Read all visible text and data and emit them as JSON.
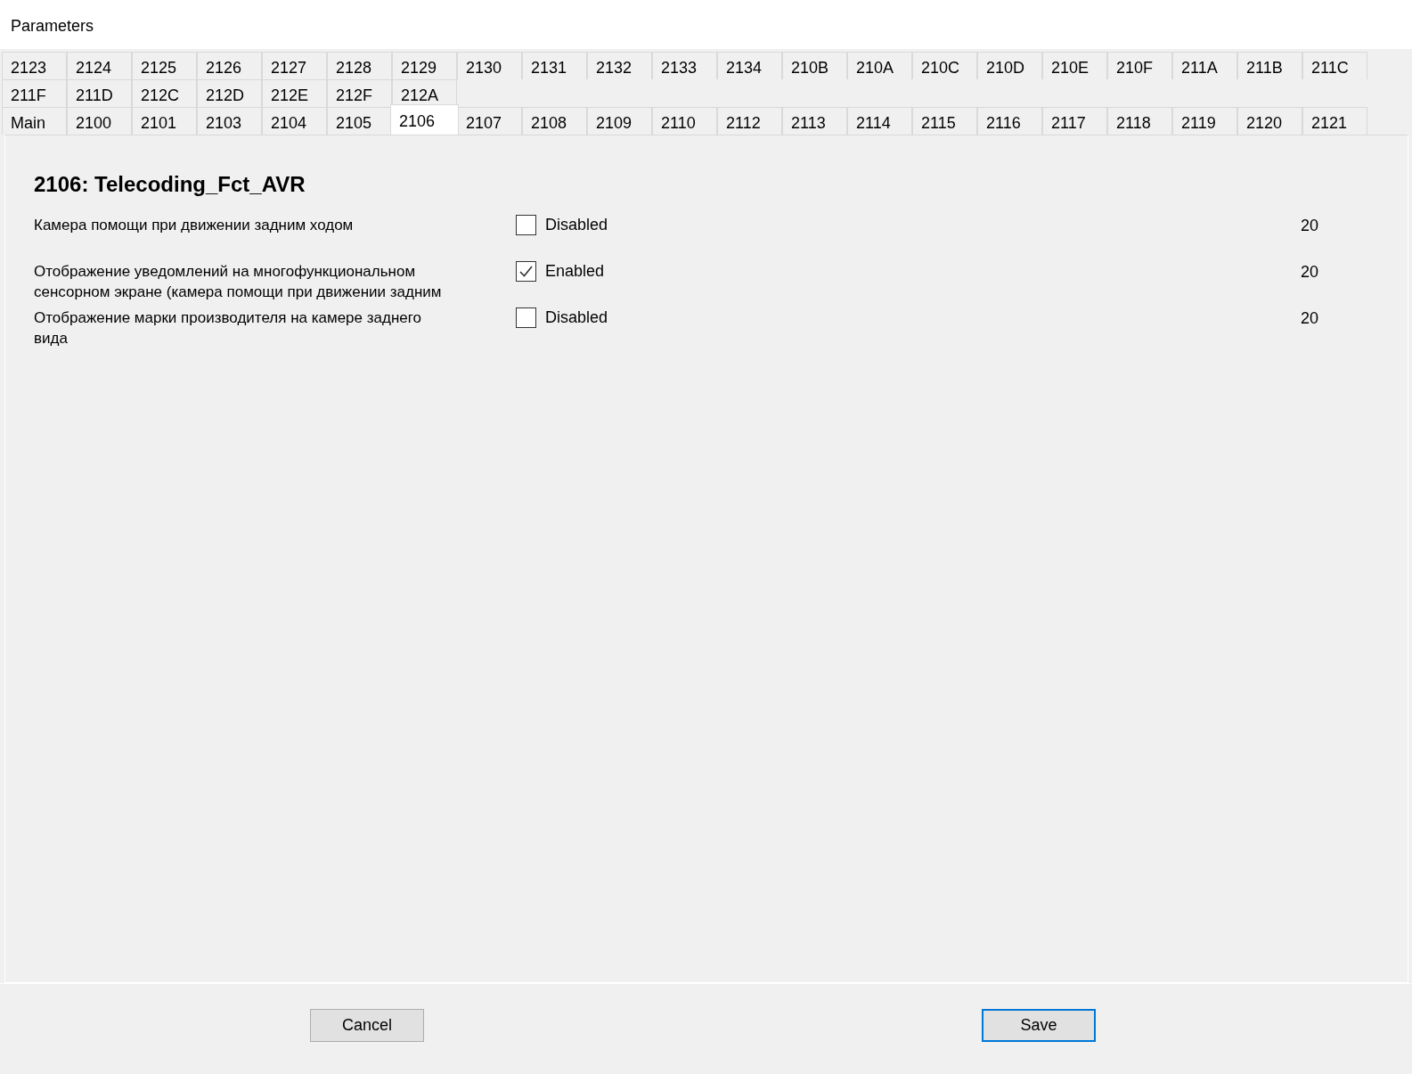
{
  "window": {
    "title": "Parameters"
  },
  "tab_rows": [
    [
      {
        "label": "2123",
        "selected": false
      },
      {
        "label": "2124",
        "selected": false
      },
      {
        "label": "2125",
        "selected": false
      },
      {
        "label": "2126",
        "selected": false
      },
      {
        "label": "2127",
        "selected": false
      },
      {
        "label": "2128",
        "selected": false
      },
      {
        "label": "2129",
        "selected": false
      },
      {
        "label": "2130",
        "selected": false
      },
      {
        "label": "2131",
        "selected": false
      },
      {
        "label": "2132",
        "selected": false
      },
      {
        "label": "2133",
        "selected": false
      },
      {
        "label": "2134",
        "selected": false
      },
      {
        "label": "210B",
        "selected": false
      },
      {
        "label": "210A",
        "selected": false
      },
      {
        "label": "210C",
        "selected": false
      },
      {
        "label": "210D",
        "selected": false
      },
      {
        "label": "210E",
        "selected": false
      },
      {
        "label": "210F",
        "selected": false
      },
      {
        "label": "211A",
        "selected": false
      },
      {
        "label": "211B",
        "selected": false
      },
      {
        "label": "211C",
        "selected": false
      }
    ],
    [
      {
        "label": "211F",
        "selected": false
      },
      {
        "label": "211D",
        "selected": false
      },
      {
        "label": "212C",
        "selected": false
      },
      {
        "label": "212D",
        "selected": false
      },
      {
        "label": "212E",
        "selected": false
      },
      {
        "label": "212F",
        "selected": false
      },
      {
        "label": "212A",
        "selected": false
      }
    ],
    [
      {
        "label": "Main",
        "selected": false
      },
      {
        "label": "2100",
        "selected": false
      },
      {
        "label": "2101",
        "selected": false
      },
      {
        "label": "2103",
        "selected": false
      },
      {
        "label": "2104",
        "selected": false
      },
      {
        "label": "2105",
        "selected": false
      },
      {
        "label": "2106",
        "selected": true
      },
      {
        "label": "2107",
        "selected": false
      },
      {
        "label": "2108",
        "selected": false
      },
      {
        "label": "2109",
        "selected": false
      },
      {
        "label": "2110",
        "selected": false
      },
      {
        "label": "2112",
        "selected": false
      },
      {
        "label": "2113",
        "selected": false
      },
      {
        "label": "2114",
        "selected": false
      },
      {
        "label": "2115",
        "selected": false
      },
      {
        "label": "2116",
        "selected": false
      },
      {
        "label": "2117",
        "selected": false
      },
      {
        "label": "2118",
        "selected": false
      },
      {
        "label": "2119",
        "selected": false
      },
      {
        "label": "2120",
        "selected": false
      },
      {
        "label": "2121",
        "selected": false
      }
    ]
  ],
  "panel": {
    "heading": "2106: Telecoding_Fct_AVR",
    "parameters": [
      {
        "label": "Камера помощи при движении задним ходом",
        "checked": false,
        "state_text": "Disabled",
        "value": "20"
      },
      {
        "label": "Отображение уведомлений на многофункциональном\nсенсорном экране (камера помощи при движении задним",
        "checked": true,
        "state_text": "Enabled",
        "value": "20"
      },
      {
        "label": "Отображение марки производителя на камере заднего\nвида",
        "checked": false,
        "state_text": "Disabled",
        "value": "20"
      }
    ]
  },
  "buttons": [
    {
      "label": "Cancel",
      "kind": "normal"
    },
    {
      "label": "Save",
      "kind": "default"
    }
  ]
}
